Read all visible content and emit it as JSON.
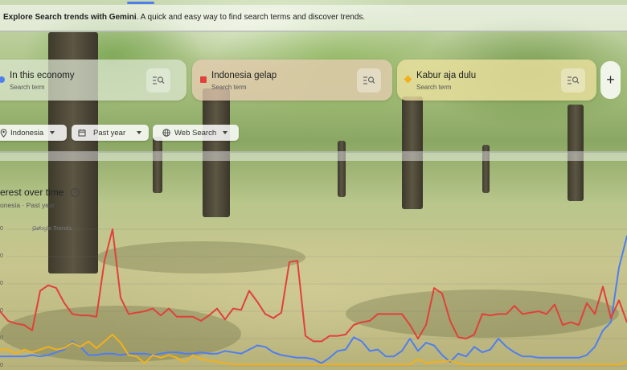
{
  "intro": {
    "bold": "Explore Search trends with Gemini",
    "rest": ". A quick and easy way to find search terms and discover trends."
  },
  "terms": [
    {
      "title": "In this economy",
      "subtitle": "Search term",
      "color": "#4f7ef0"
    },
    {
      "title": "Indonesia gelap",
      "subtitle": "Search term",
      "color": "#e0413a"
    },
    {
      "title": "Kabur aja dulu",
      "subtitle": "Search term",
      "color": "#f2b01e"
    }
  ],
  "add_button": "+",
  "filters": {
    "region": "Indonesia",
    "period": "Past year",
    "property": "Web Search"
  },
  "chart_header": {
    "title": "erest over time",
    "info": "i",
    "subtitle": "onesia · Past year",
    "watermark": "Google Trends"
  },
  "chart_data": {
    "type": "line",
    "title": "erest over time",
    "xlabel": "",
    "ylabel": "",
    "ylim": [
      0,
      100
    ],
    "y_ticks": [
      {
        "value": 100,
        "label": "0"
      },
      {
        "value": 80,
        "label": "0"
      },
      {
        "value": 60,
        "label": "0"
      },
      {
        "value": 40,
        "label": "0"
      },
      {
        "value": 20,
        "label": "0"
      },
      {
        "value": 0,
        "label": "0"
      }
    ],
    "grid": true,
    "series": [
      {
        "color": "#4f7ef0",
        "x": [
          0,
          10,
          20,
          30,
          40,
          50,
          60,
          70,
          80,
          90,
          100,
          110,
          120,
          130,
          140,
          150,
          160,
          170,
          180,
          190,
          200,
          210,
          220,
          230,
          240,
          250,
          260,
          270,
          280,
          290,
          300,
          310,
          320,
          330,
          340,
          350,
          360,
          370,
          380,
          390,
          400,
          410,
          420,
          430,
          440,
          450,
          460,
          470,
          480,
          490,
          500,
          510,
          520,
          530,
          540,
          550,
          560,
          570,
          580,
          590,
          600,
          610,
          620,
          630,
          640,
          650,
          660,
          670,
          680,
          690,
          700,
          710,
          720,
          730,
          740,
          750,
          760,
          770,
          780
        ],
        "y": [
          7,
          7,
          7,
          7,
          8,
          7,
          8,
          10,
          12,
          18,
          14,
          8,
          8,
          9,
          9,
          8,
          9,
          9,
          9,
          8,
          9,
          10,
          10,
          9,
          9,
          10,
          9,
          9,
          11,
          10,
          9,
          12,
          15,
          14,
          10,
          8,
          7,
          6,
          6,
          5,
          2,
          6,
          11,
          12,
          21,
          18,
          11,
          12,
          7,
          7,
          11,
          20,
          11,
          17,
          15,
          8,
          3,
          9,
          7,
          14,
          10,
          12,
          20,
          14,
          10,
          7,
          7,
          6,
          6,
          6,
          6,
          6,
          6,
          8,
          14,
          26,
          32,
          72,
          95
        ]
      },
      {
        "color": "#e0413a",
        "x": [
          0,
          10,
          20,
          30,
          40,
          50,
          60,
          70,
          80,
          90,
          100,
          110,
          120,
          130,
          140,
          150,
          160,
          170,
          180,
          190,
          200,
          210,
          220,
          230,
          240,
          250,
          260,
          270,
          280,
          290,
          300,
          310,
          320,
          330,
          340,
          350,
          360,
          370,
          380,
          390,
          400,
          410,
          420,
          430,
          440,
          450,
          460,
          470,
          480,
          490,
          500,
          510,
          520,
          530,
          540,
          550,
          560,
          570,
          580,
          590,
          600,
          610,
          620,
          630,
          640,
          650,
          660,
          670,
          680,
          690,
          700,
          710,
          720,
          730,
          740,
          750,
          760,
          770,
          780
        ],
        "y": [
          40,
          33,
          31,
          30,
          26,
          55,
          59,
          57,
          46,
          38,
          37,
          37,
          36,
          77,
          100,
          50,
          38,
          39,
          40,
          42,
          37,
          42,
          36,
          36,
          36,
          33,
          37,
          42,
          34,
          42,
          41,
          55,
          47,
          38,
          35,
          39,
          76,
          77,
          22,
          18,
          18,
          22,
          22,
          23,
          30,
          32,
          33,
          38,
          38,
          38,
          38,
          30,
          20,
          30,
          57,
          53,
          33,
          21,
          20,
          23,
          38,
          37,
          38,
          38,
          44,
          38,
          39,
          40,
          38,
          45,
          30,
          32,
          30,
          46,
          38,
          58,
          35,
          48,
          32
        ]
      },
      {
        "color": "#f2b01e",
        "x": [
          0,
          10,
          20,
          30,
          40,
          50,
          60,
          70,
          80,
          90,
          100,
          110,
          120,
          130,
          140,
          150,
          160,
          170,
          180,
          190,
          200,
          210,
          220,
          230,
          240,
          250,
          260,
          270,
          280,
          290,
          300,
          310,
          320,
          330,
          340,
          350,
          360,
          370,
          380,
          390,
          400,
          410,
          420,
          430,
          440,
          450,
          460,
          470,
          480,
          490,
          500,
          510,
          520,
          530,
          540,
          550,
          560,
          570,
          580,
          590,
          600,
          610,
          620,
          630,
          640,
          650,
          660,
          670,
          680,
          690,
          700,
          710,
          720,
          730,
          740,
          750,
          760,
          770,
          780
        ],
        "y": [
          12,
          12,
          9,
          12,
          10,
          12,
          14,
          12,
          13,
          17,
          14,
          18,
          13,
          18,
          23,
          17,
          8,
          7,
          2,
          8,
          6,
          8,
          6,
          3,
          8,
          5,
          4,
          3,
          2,
          1,
          1,
          1,
          1,
          1,
          1,
          1,
          1,
          1,
          1,
          1,
          1,
          1,
          1,
          1,
          1,
          1,
          1,
          1,
          1,
          1,
          1,
          1,
          5,
          2,
          3,
          3,
          4,
          2,
          1,
          1,
          1,
          1,
          1,
          1,
          1,
          1,
          1,
          1,
          1,
          1,
          1,
          1,
          1,
          1,
          1,
          1,
          1,
          1,
          3
        ]
      }
    ]
  }
}
